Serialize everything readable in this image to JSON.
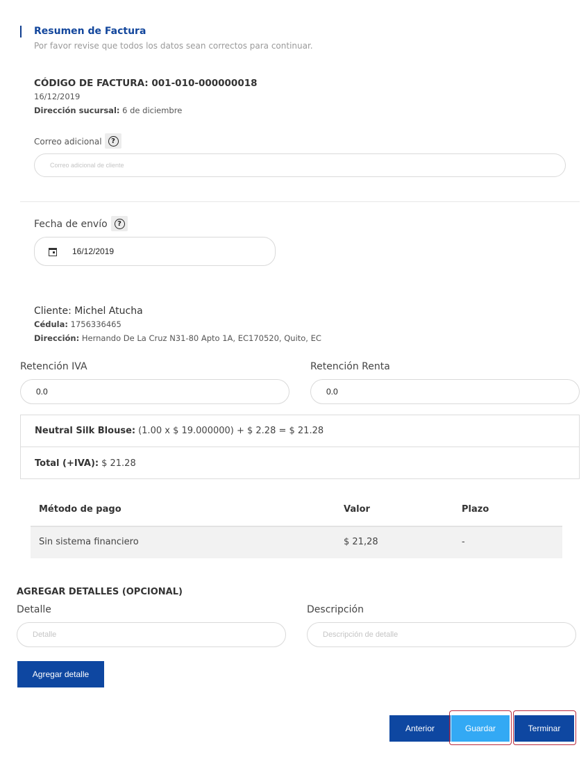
{
  "header": {
    "title": "Resumen de Factura",
    "subtitle": "Por favor revise que todos los datos sean correctos para continuar."
  },
  "invoice": {
    "code": "CÓDIGO DE FACTURA: 001-010-000000018",
    "date": "16/12/2019",
    "branch_label": "Dirección sucursal:",
    "branch_value": "6 de diciembre"
  },
  "extra_email": {
    "label": "Correo adicional",
    "placeholder": "Correo adicional de cliente",
    "help_icon": "question-circle-icon"
  },
  "send_date": {
    "label": "Fecha de envío",
    "value": "16/12/2019",
    "icon": "calendar-icon"
  },
  "client": {
    "name": "Cliente: Michel Atucha",
    "id_label": "Cédula:",
    "id_value": "1756336465",
    "address_label": "Dirección:",
    "address_value": "Hernando De La Cruz N31-80 Apto 1A, EC170520, Quito, EC"
  },
  "retentions": {
    "iva_label": "Retención IVA",
    "iva_value": "0.0",
    "renta_label": "Retención Renta",
    "renta_value": "0.0"
  },
  "summary": {
    "item_name": "Neutral Silk Blouse:",
    "item_calc": "(1.00 x $ 19.000000) + $ 2.28 = $ 21.28",
    "total_label": "Total (+IVA):",
    "total_value": "$ 21.28"
  },
  "payments": {
    "headers": [
      "Método de pago",
      "Valor",
      "Plazo"
    ],
    "rows": [
      [
        "Sin sistema financiero",
        "$ 21,28",
        "-"
      ]
    ]
  },
  "details": {
    "title": "AGREGAR DETALLES (OPCIONAL)",
    "detail_label": "Detalle",
    "detail_placeholder": "Detalle",
    "description_label": "Descripción",
    "description_placeholder": "Descripción de detalle",
    "add_button": "Agregar detalle"
  },
  "footer": {
    "previous": "Anterior",
    "save": "Guardar",
    "finish": "Terminar"
  },
  "colors": {
    "primary": "#0e47a1",
    "save": "#33a9f4",
    "title": "#12469c"
  }
}
